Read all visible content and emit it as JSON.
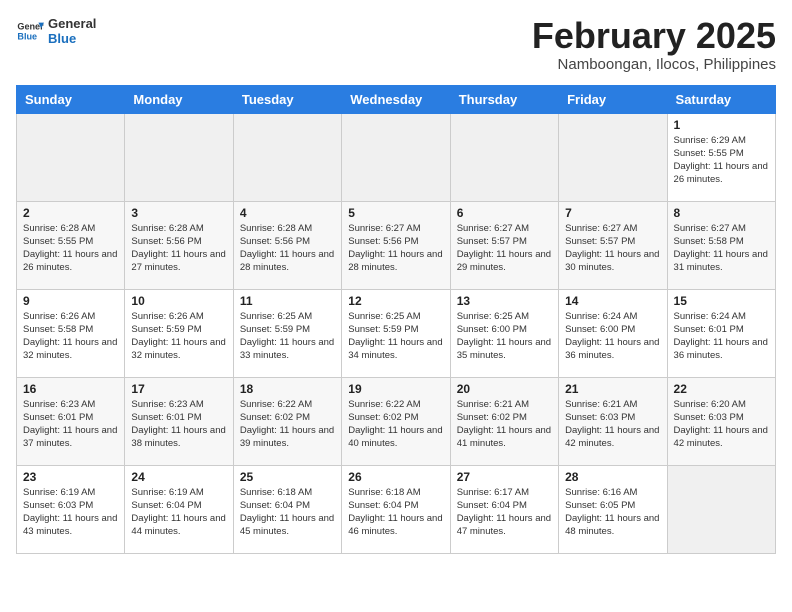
{
  "header": {
    "logo_general": "General",
    "logo_blue": "Blue",
    "month_year": "February 2025",
    "location": "Namboongan, Ilocos, Philippines"
  },
  "weekdays": [
    "Sunday",
    "Monday",
    "Tuesday",
    "Wednesday",
    "Thursday",
    "Friday",
    "Saturday"
  ],
  "weeks": [
    [
      {
        "day": "",
        "info": ""
      },
      {
        "day": "",
        "info": ""
      },
      {
        "day": "",
        "info": ""
      },
      {
        "day": "",
        "info": ""
      },
      {
        "day": "",
        "info": ""
      },
      {
        "day": "",
        "info": ""
      },
      {
        "day": "1",
        "info": "Sunrise: 6:29 AM\nSunset: 5:55 PM\nDaylight: 11 hours and 26 minutes."
      }
    ],
    [
      {
        "day": "2",
        "info": "Sunrise: 6:28 AM\nSunset: 5:55 PM\nDaylight: 11 hours and 26 minutes."
      },
      {
        "day": "3",
        "info": "Sunrise: 6:28 AM\nSunset: 5:56 PM\nDaylight: 11 hours and 27 minutes."
      },
      {
        "day": "4",
        "info": "Sunrise: 6:28 AM\nSunset: 5:56 PM\nDaylight: 11 hours and 28 minutes."
      },
      {
        "day": "5",
        "info": "Sunrise: 6:27 AM\nSunset: 5:56 PM\nDaylight: 11 hours and 28 minutes."
      },
      {
        "day": "6",
        "info": "Sunrise: 6:27 AM\nSunset: 5:57 PM\nDaylight: 11 hours and 29 minutes."
      },
      {
        "day": "7",
        "info": "Sunrise: 6:27 AM\nSunset: 5:57 PM\nDaylight: 11 hours and 30 minutes."
      },
      {
        "day": "8",
        "info": "Sunrise: 6:27 AM\nSunset: 5:58 PM\nDaylight: 11 hours and 31 minutes."
      }
    ],
    [
      {
        "day": "9",
        "info": "Sunrise: 6:26 AM\nSunset: 5:58 PM\nDaylight: 11 hours and 32 minutes."
      },
      {
        "day": "10",
        "info": "Sunrise: 6:26 AM\nSunset: 5:59 PM\nDaylight: 11 hours and 32 minutes."
      },
      {
        "day": "11",
        "info": "Sunrise: 6:25 AM\nSunset: 5:59 PM\nDaylight: 11 hours and 33 minutes."
      },
      {
        "day": "12",
        "info": "Sunrise: 6:25 AM\nSunset: 5:59 PM\nDaylight: 11 hours and 34 minutes."
      },
      {
        "day": "13",
        "info": "Sunrise: 6:25 AM\nSunset: 6:00 PM\nDaylight: 11 hours and 35 minutes."
      },
      {
        "day": "14",
        "info": "Sunrise: 6:24 AM\nSunset: 6:00 PM\nDaylight: 11 hours and 36 minutes."
      },
      {
        "day": "15",
        "info": "Sunrise: 6:24 AM\nSunset: 6:01 PM\nDaylight: 11 hours and 36 minutes."
      }
    ],
    [
      {
        "day": "16",
        "info": "Sunrise: 6:23 AM\nSunset: 6:01 PM\nDaylight: 11 hours and 37 minutes."
      },
      {
        "day": "17",
        "info": "Sunrise: 6:23 AM\nSunset: 6:01 PM\nDaylight: 11 hours and 38 minutes."
      },
      {
        "day": "18",
        "info": "Sunrise: 6:22 AM\nSunset: 6:02 PM\nDaylight: 11 hours and 39 minutes."
      },
      {
        "day": "19",
        "info": "Sunrise: 6:22 AM\nSunset: 6:02 PM\nDaylight: 11 hours and 40 minutes."
      },
      {
        "day": "20",
        "info": "Sunrise: 6:21 AM\nSunset: 6:02 PM\nDaylight: 11 hours and 41 minutes."
      },
      {
        "day": "21",
        "info": "Sunrise: 6:21 AM\nSunset: 6:03 PM\nDaylight: 11 hours and 42 minutes."
      },
      {
        "day": "22",
        "info": "Sunrise: 6:20 AM\nSunset: 6:03 PM\nDaylight: 11 hours and 42 minutes."
      }
    ],
    [
      {
        "day": "23",
        "info": "Sunrise: 6:19 AM\nSunset: 6:03 PM\nDaylight: 11 hours and 43 minutes."
      },
      {
        "day": "24",
        "info": "Sunrise: 6:19 AM\nSunset: 6:04 PM\nDaylight: 11 hours and 44 minutes."
      },
      {
        "day": "25",
        "info": "Sunrise: 6:18 AM\nSunset: 6:04 PM\nDaylight: 11 hours and 45 minutes."
      },
      {
        "day": "26",
        "info": "Sunrise: 6:18 AM\nSunset: 6:04 PM\nDaylight: 11 hours and 46 minutes."
      },
      {
        "day": "27",
        "info": "Sunrise: 6:17 AM\nSunset: 6:04 PM\nDaylight: 11 hours and 47 minutes."
      },
      {
        "day": "28",
        "info": "Sunrise: 6:16 AM\nSunset: 6:05 PM\nDaylight: 11 hours and 48 minutes."
      },
      {
        "day": "",
        "info": ""
      }
    ]
  ]
}
